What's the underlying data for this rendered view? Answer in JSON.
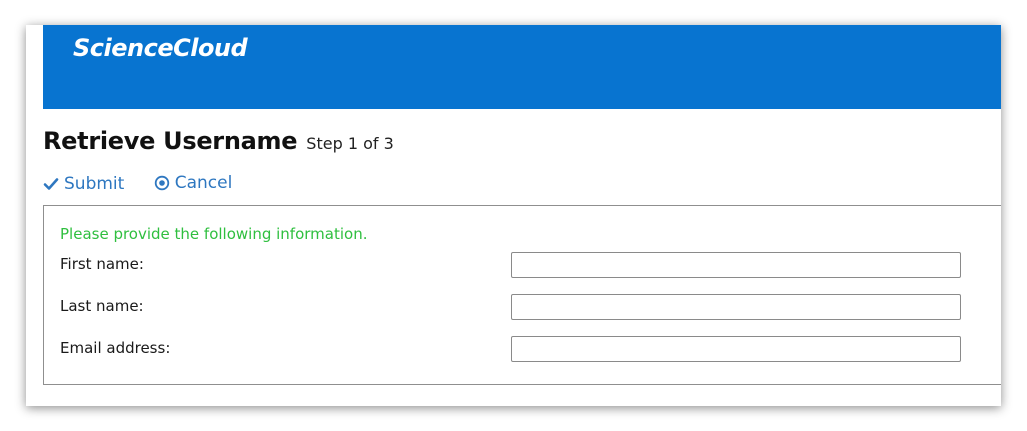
{
  "app": {
    "brand": "ScienceCloud",
    "accent_color": "#0874d0"
  },
  "page": {
    "title": "Retrieve Username",
    "step_text": "Step 1 of 3"
  },
  "actions": {
    "submit_label": "Submit",
    "submit_icon": "check-icon",
    "cancel_label": "Cancel",
    "cancel_icon": "cancel-circle-icon",
    "link_color": "#2e77c0"
  },
  "form": {
    "instructions": "Please provide the following information.",
    "instructions_color": "#2fbf3f",
    "fields": [
      {
        "label": "First name:",
        "value": "",
        "placeholder": ""
      },
      {
        "label": "Last name:",
        "value": "",
        "placeholder": ""
      },
      {
        "label": "Email address:",
        "value": "",
        "placeholder": ""
      }
    ]
  }
}
